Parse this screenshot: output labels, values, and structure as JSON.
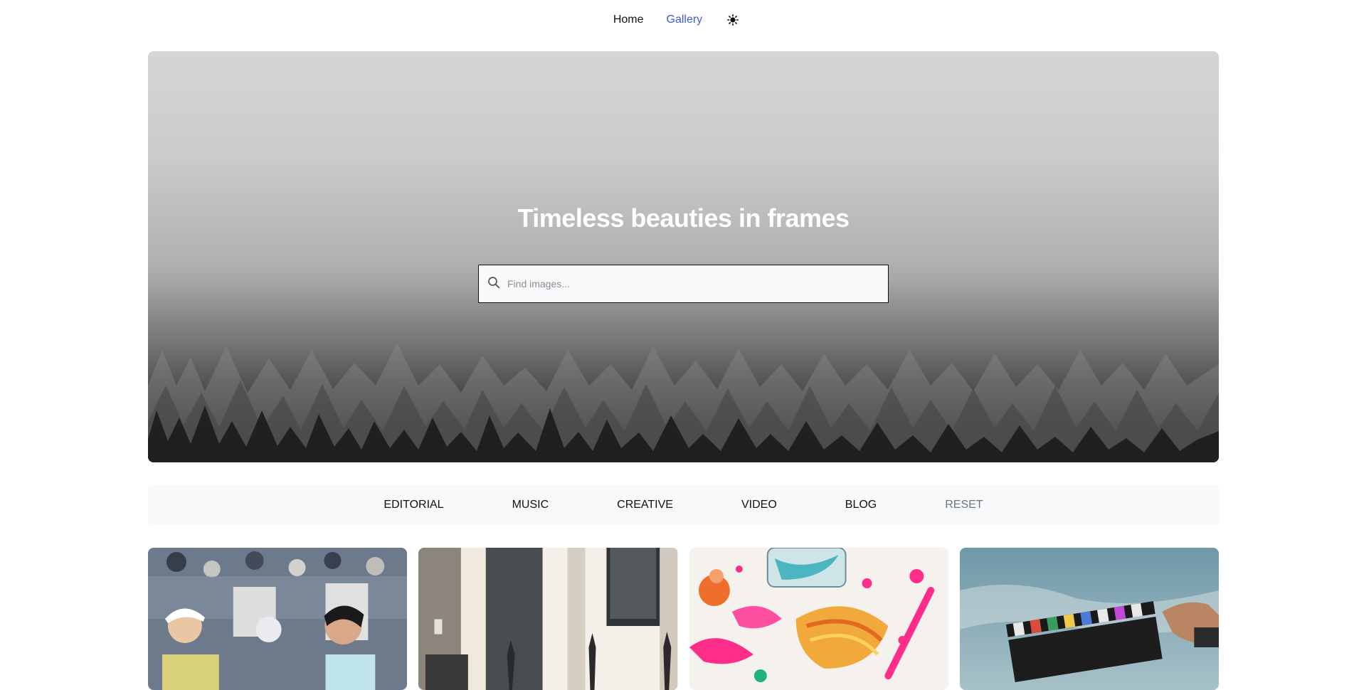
{
  "nav": {
    "items": [
      {
        "label": "Home",
        "active": false
      },
      {
        "label": "Gallery",
        "active": true
      }
    ],
    "theme_toggle_icon": "sun-icon",
    "accent_color": "#3b5bdb"
  },
  "hero": {
    "title": "Timeless beauties in frames",
    "image_icon": "foggy-forest-image"
  },
  "search": {
    "placeholder": "Find images...",
    "value": "",
    "icon": "search-icon"
  },
  "filters": [
    {
      "label": "EDITORIAL"
    },
    {
      "label": "MUSIC"
    },
    {
      "label": "CREATIVE"
    },
    {
      "label": "VIDEO"
    },
    {
      "label": "BLOG"
    },
    {
      "label": "RESET"
    }
  ],
  "gallery": {
    "items": [
      {
        "image": "tennis-players-image"
      },
      {
        "image": "music-studio-image"
      },
      {
        "image": "paint-splatter-image"
      },
      {
        "image": "film-clapperboard-image"
      }
    ]
  }
}
